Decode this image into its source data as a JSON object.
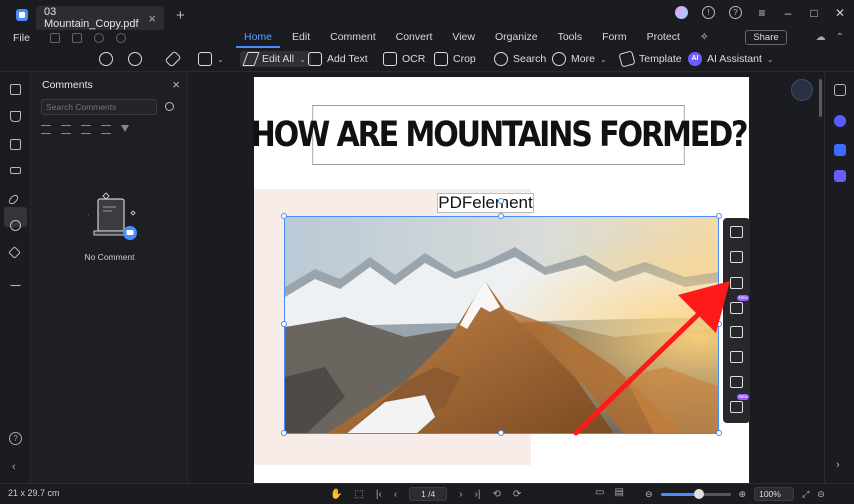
{
  "titlebar": {
    "doc_tab": "03 Mountain_Copy.pdf",
    "close_glyph": "×",
    "new_tab_glyph": "+"
  },
  "menubar": {
    "file": "File",
    "tabs": [
      "Home",
      "Edit",
      "Comment",
      "Convert",
      "View",
      "Organize",
      "Tools",
      "Form",
      "Protect"
    ],
    "share": "Share"
  },
  "toolbar": {
    "edit_all": "Edit All",
    "add_text": "Add Text",
    "ocr": "OCR",
    "crop": "Crop",
    "search": "Search",
    "more": "More",
    "template": "Template",
    "ai_badge": "AI",
    "ai_assistant": "AI Assistant"
  },
  "comments_panel": {
    "title": "Comments",
    "search_placeholder": "Search Comments",
    "empty_text": "No Comment"
  },
  "document": {
    "heading": "HOW ARE MOUNTAINS FORMED?",
    "label": "PDFelement"
  },
  "floating_toolbar": {
    "new_tag": "New"
  },
  "statusbar": {
    "page_size": "21 x 29.7 cm",
    "page_indicator": "1 /4",
    "zoom": "100%"
  },
  "icons": {
    "help": "?",
    "arrow_color": "#ff1a1a",
    "accent": "#4a8cff"
  }
}
